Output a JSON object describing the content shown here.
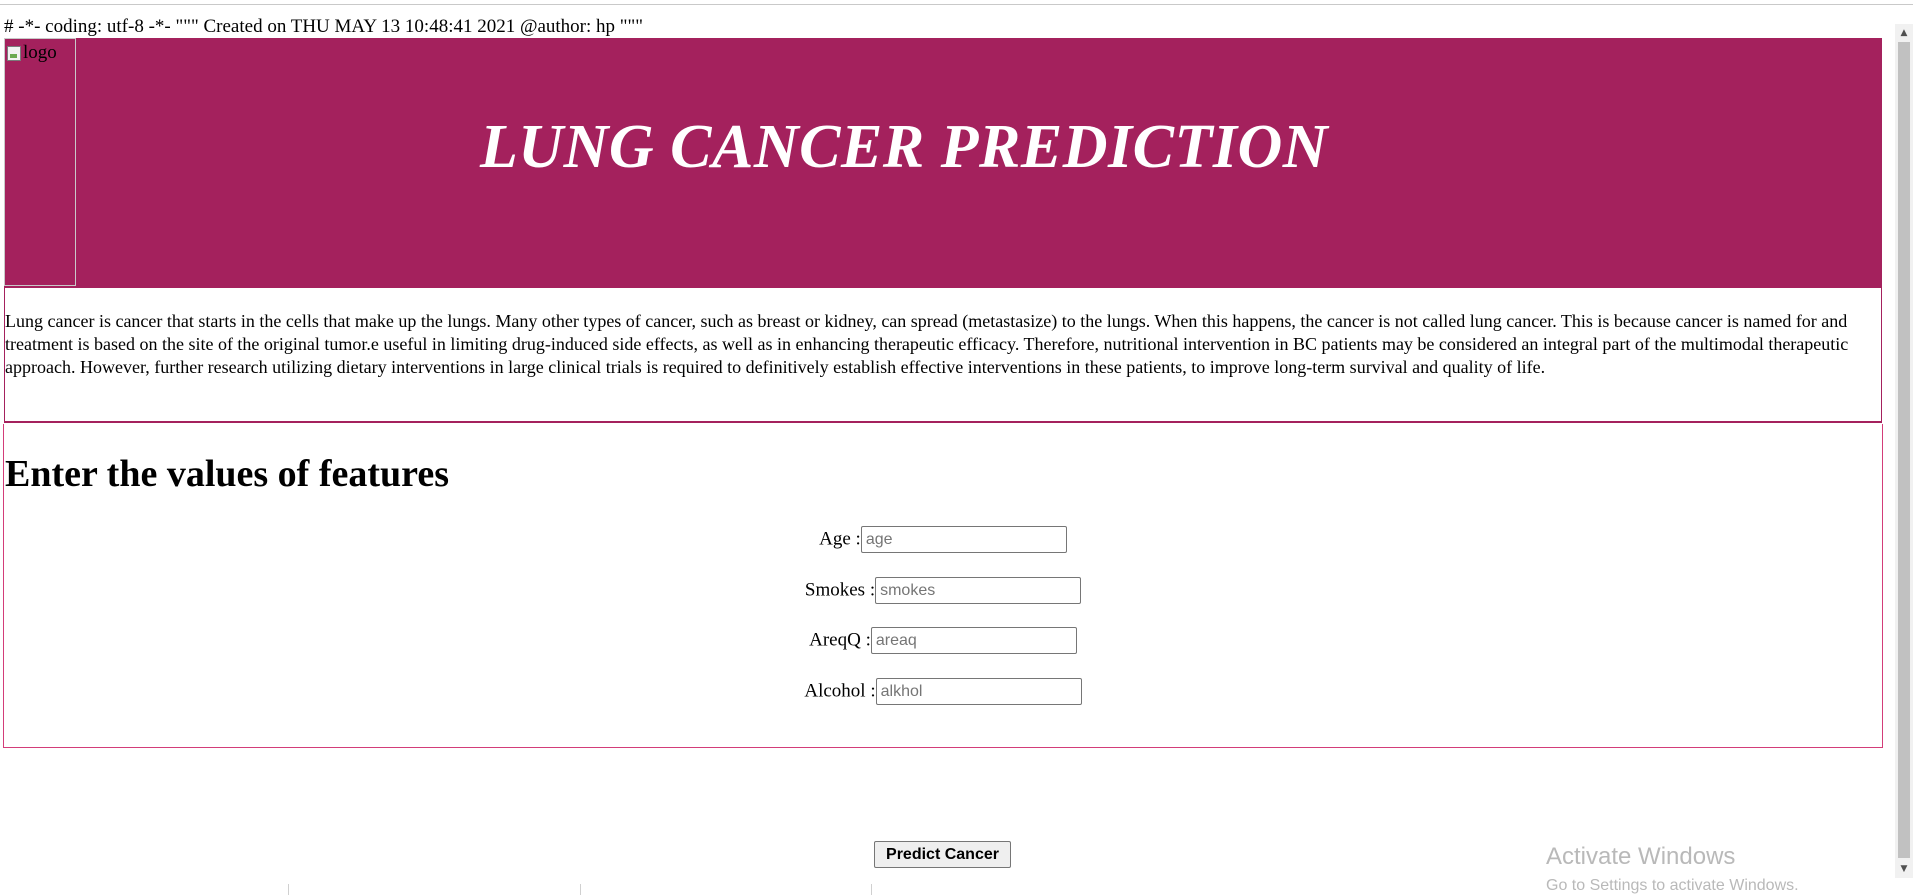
{
  "header_comment": "# -*- coding: utf-8 -*- \"\"\" Created on THU MAY 13 10:48:41 2021 @author: hp \"\"\"",
  "banner": {
    "logo_alt": "logo",
    "title": "LUNG CANCER PREDICTION",
    "background_color": "#a4215d"
  },
  "description": "Lung cancer is cancer that starts in the cells that make up the lungs. Many other types of cancer, such as breast or kidney, can spread (metastasize) to the lungs. When this happens, the cancer is not called lung cancer. This is because cancer is named for and treatment is based on the site of the original tumor.e useful in limiting drug-induced side effects, as well as in enhancing therapeutic efficacy. Therefore, nutritional intervention in BC patients may be considered an integral part of the multimodal therapeutic approach. However, further research utilizing dietary interventions in large clinical trials is required to definitively establish effective interventions in these patients, to improve long-term survival and quality of life.",
  "form": {
    "heading": "Enter the values of features",
    "fields": [
      {
        "label": "Age :",
        "placeholder": "age",
        "value": ""
      },
      {
        "label": "Smokes :",
        "placeholder": "smokes",
        "value": ""
      },
      {
        "label": "AreqQ :",
        "placeholder": "areaq",
        "value": ""
      },
      {
        "label": "Alcohol :",
        "placeholder": "alkhol",
        "value": ""
      }
    ],
    "submit_label": "Predict Cancer"
  },
  "watermark": {
    "title": "Activate Windows",
    "subtitle": "Go to Settings to activate Windows."
  }
}
